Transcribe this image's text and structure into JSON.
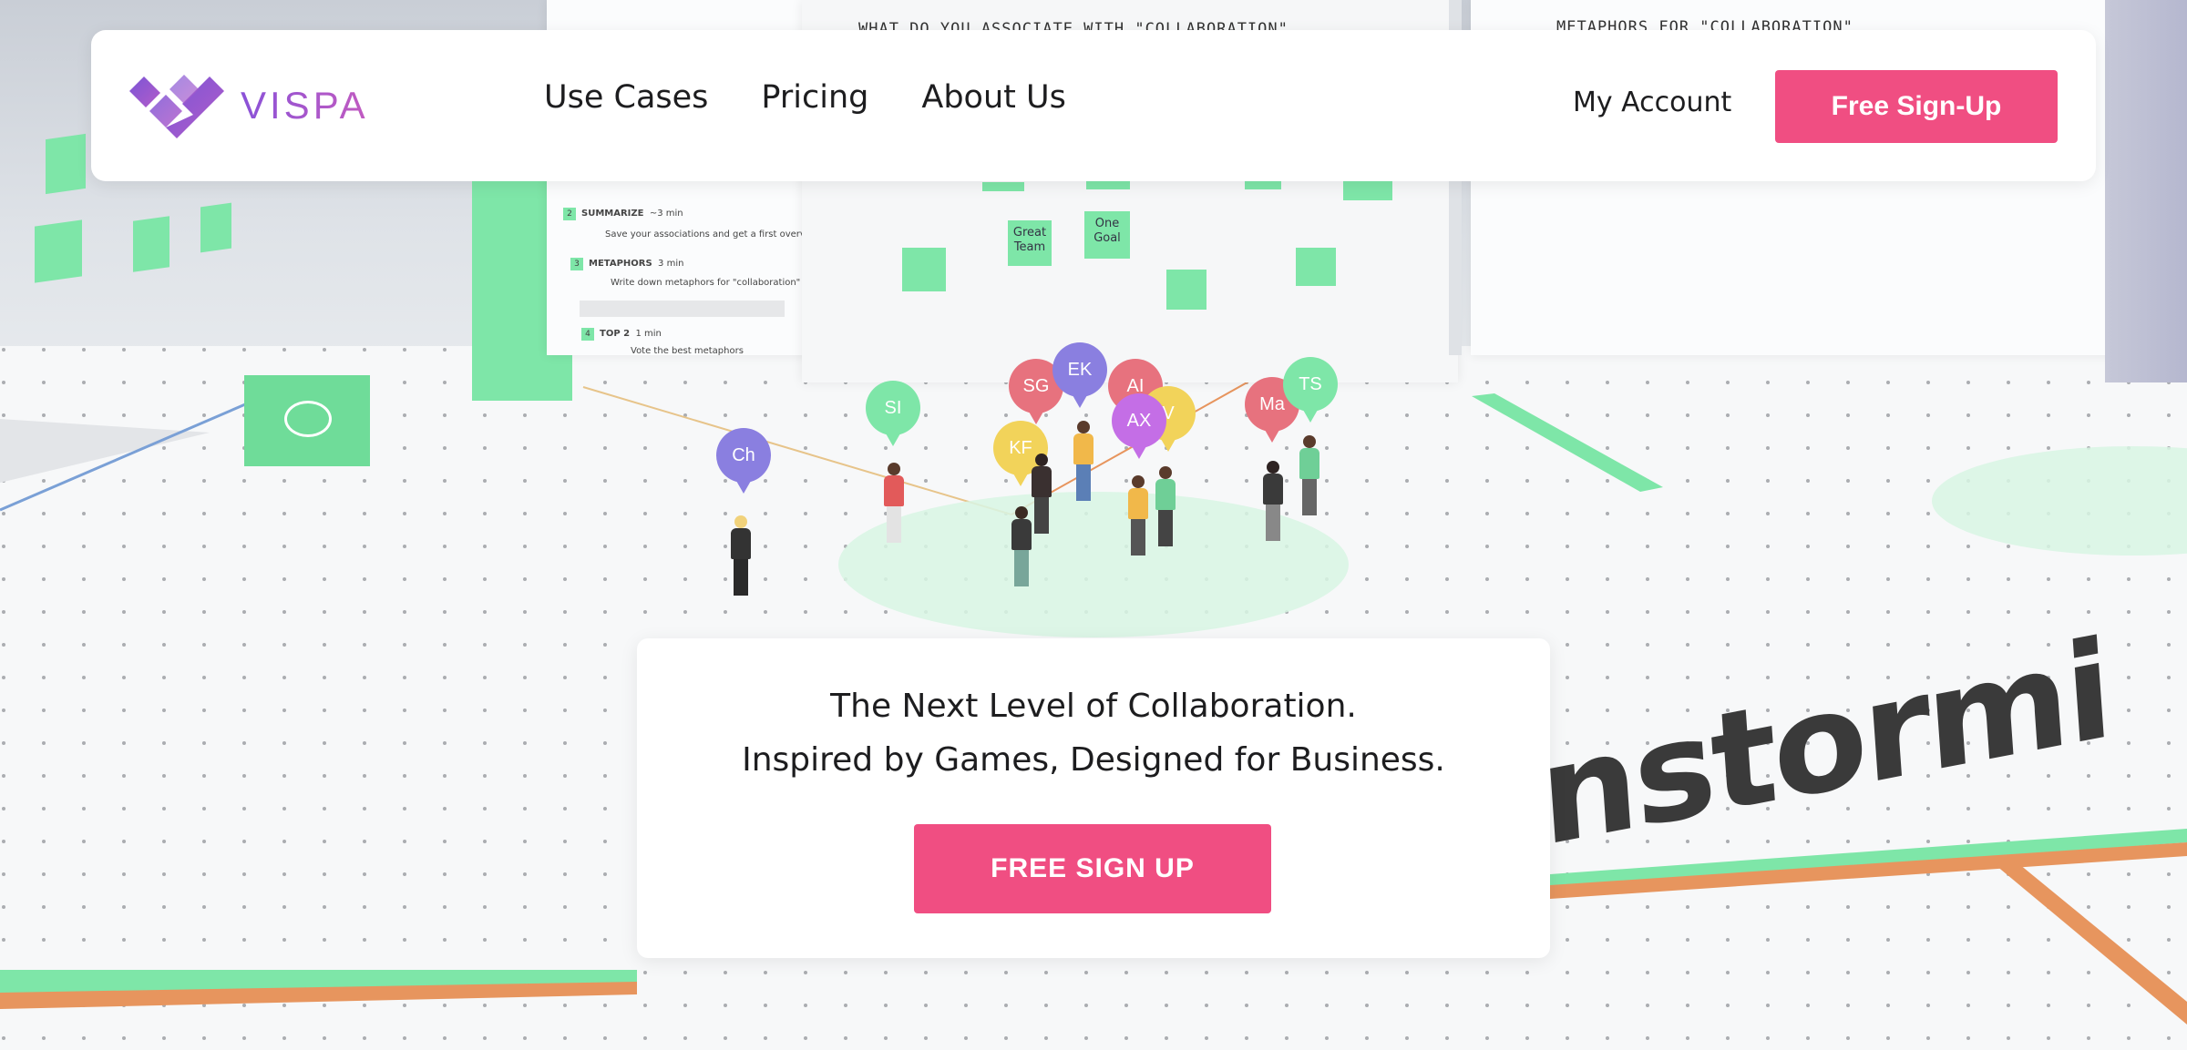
{
  "brand": {
    "name": "VISPA",
    "accent": "#a355cc"
  },
  "nav": {
    "items": [
      {
        "label": "Use Cases"
      },
      {
        "label": "Pricing"
      },
      {
        "label": "About Us"
      }
    ],
    "account_label": "My Account",
    "signup_label": "Free Sign-Up"
  },
  "hero": {
    "line1": "The Next Level of Collaboration.",
    "line2": "Inspired by Games, Designed for Business.",
    "cta_label": "FREE SIGN UP"
  },
  "scene": {
    "wall_title_left": "WHAT DO YOU ASSOCIATE WITH \"COLLABORATION\"",
    "wall_title_right": "METAPHORS FOR \"COLLABORATION\"",
    "sticky_notes": [
      "Great Team",
      "One Goal"
    ],
    "steps": [
      {
        "num": "2",
        "title": "SUMMARIZE",
        "time": "~3 min",
        "desc": "Save your associations and get a first overview"
      },
      {
        "num": "3",
        "title": "METAPHORS",
        "time": "3 min",
        "desc": "Write down metaphors for \"collaboration\""
      },
      {
        "num": "4",
        "title": "TOP 2",
        "time": "1 min",
        "desc": "Vote the best metaphors"
      }
    ],
    "avatars": [
      "Ch",
      "SI",
      "SG",
      "EK",
      "AI",
      "AX",
      "KF",
      "V",
      "Ma",
      "TS"
    ],
    "floor_text": "nstormi"
  },
  "colors": {
    "cta": "#f04e82",
    "sticky": "#7ee6a8",
    "background": "#eef1f4"
  }
}
